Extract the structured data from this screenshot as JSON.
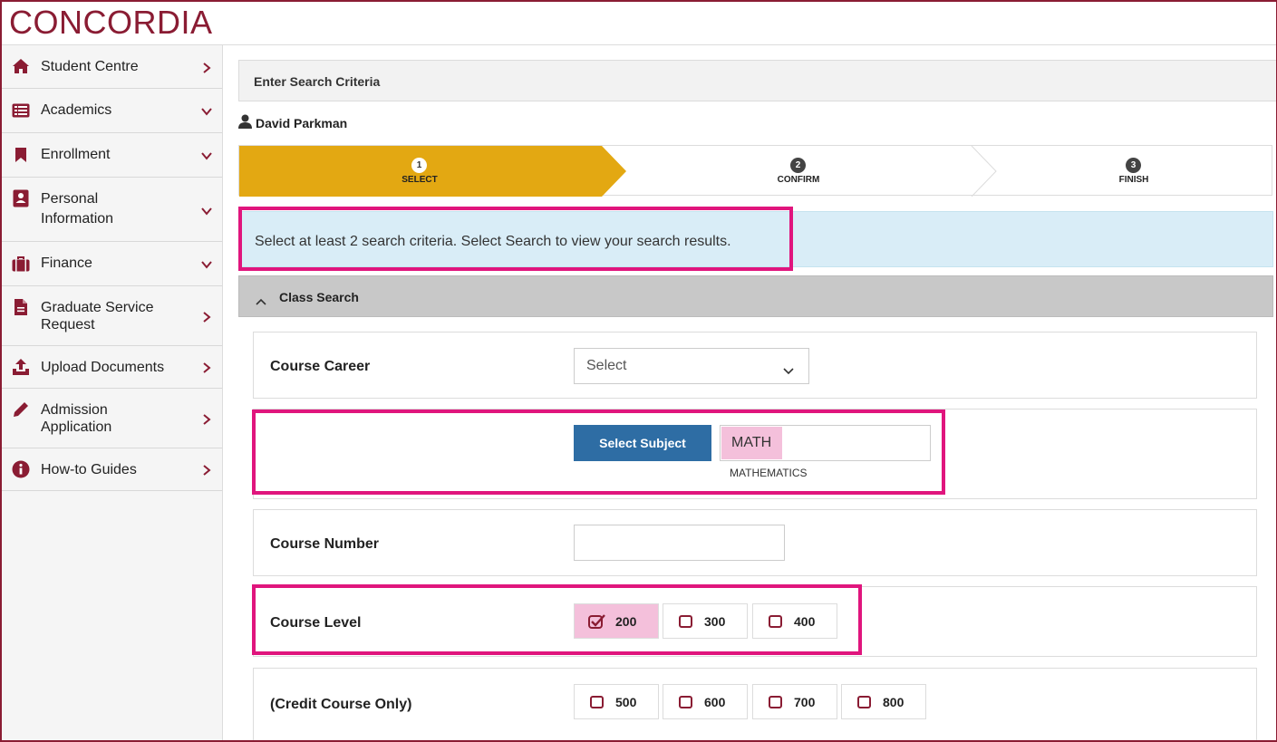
{
  "brand": {
    "name": "CONCORDIA",
    "color": "#8a1c33"
  },
  "sidebar": {
    "items": [
      {
        "label": "Student Centre",
        "icon": "home-icon",
        "arrow": "chevron-right"
      },
      {
        "label": "Academics",
        "icon": "list-icon",
        "arrow": "chevron-down"
      },
      {
        "label": "Enrollment",
        "icon": "bookmark-icon",
        "arrow": "chevron-down"
      },
      {
        "label_line1": "Personal",
        "label_line2": "Information",
        "icon": "contact-card-icon",
        "arrow": "chevron-down"
      },
      {
        "label": "Finance",
        "icon": "briefcase-icon",
        "arrow": "chevron-down"
      },
      {
        "label_line1": "Graduate Service",
        "label_line2": "Request",
        "icon": "document-icon",
        "arrow": "chevron-right"
      },
      {
        "label": "Upload Documents",
        "icon": "upload-icon",
        "arrow": "chevron-right"
      },
      {
        "label_line1": "Admission",
        "label_line2": "Application",
        "icon": "pencil-icon",
        "arrow": "chevron-right"
      },
      {
        "label": "How-to Guides",
        "icon": "info-icon",
        "arrow": "chevron-right"
      }
    ]
  },
  "main": {
    "criteria_title": "Enter Search Criteria",
    "user_name": "David Parkman",
    "steps": [
      {
        "num": "1",
        "label": "SELECT",
        "active": true
      },
      {
        "num": "2",
        "label": "CONFIRM",
        "active": false
      },
      {
        "num": "3",
        "label": "FINISH",
        "active": false
      }
    ],
    "info_message": "Select at least 2 search criteria. Select Search to view your search results.",
    "class_search_title": "Class Search",
    "course_career": {
      "label": "Course Career",
      "value": "Select"
    },
    "subject": {
      "button_label": "Select Subject",
      "code": "MATH",
      "description": "MATHEMATICS"
    },
    "course_number": {
      "label": "Course Number",
      "value": ""
    },
    "course_level": {
      "label": "Course Level",
      "options": [
        {
          "value": "200",
          "checked": true
        },
        {
          "value": "300",
          "checked": false
        },
        {
          "value": "400",
          "checked": false
        }
      ]
    },
    "credit_course": {
      "label": "(Credit Course Only)",
      "options": [
        {
          "value": "500",
          "checked": false
        },
        {
          "value": "600",
          "checked": false
        },
        {
          "value": "700",
          "checked": false
        },
        {
          "value": "800",
          "checked": false
        }
      ]
    }
  },
  "colors": {
    "accent": "#8a1c33",
    "step_active": "#e3a812",
    "button": "#2e6da4",
    "highlight": "#e0157d",
    "info_bg": "#d9edf7"
  }
}
